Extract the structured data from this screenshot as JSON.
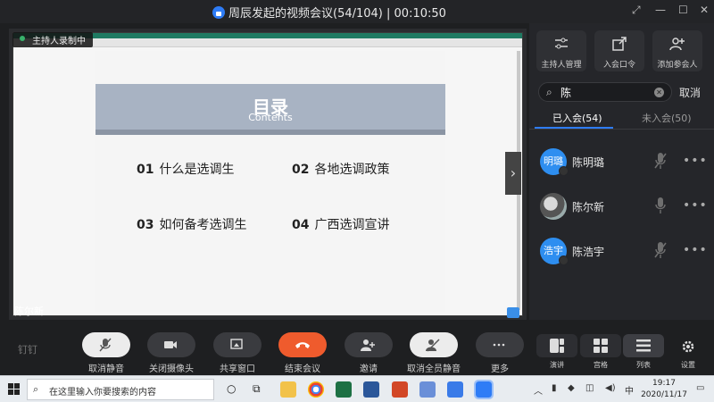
{
  "window": {
    "title": "周辰发起的视频会议(54/104)  |  00:10:50"
  },
  "stage": {
    "recording_badge": "主持人录制中",
    "speaker_name": "陈尔新",
    "slide": {
      "title": "目录",
      "subtitle": "Contents",
      "items": [
        {
          "num": "01",
          "text": "什么是选调生"
        },
        {
          "num": "02",
          "text": "各地选调政策"
        },
        {
          "num": "03",
          "text": "如何备考选调生"
        },
        {
          "num": "04",
          "text": "广西选调宣讲"
        }
      ]
    }
  },
  "panel": {
    "actions": [
      {
        "label": "主持人管理",
        "icon": "sliders-icon"
      },
      {
        "label": "入会口令",
        "icon": "share-icon"
      },
      {
        "label": "添加参会人",
        "icon": "add-user-icon"
      }
    ],
    "search": {
      "value": "陈",
      "cancel_label": "取消"
    },
    "tabs": [
      {
        "label": "已入会(54)",
        "active": true
      },
      {
        "label": "未入会(50)",
        "active": false
      }
    ],
    "members": [
      {
        "avatar_text": "明璐",
        "name": "陈明璐",
        "mic": "muted",
        "more": "•••"
      },
      {
        "avatar_text": "",
        "name": "陈尔新",
        "mic": "on",
        "more": "•••"
      },
      {
        "avatar_text": "浩宇",
        "name": "陈浩宇",
        "mic": "muted",
        "more": "•••"
      }
    ]
  },
  "toolbar": {
    "logo": "钉钉",
    "buttons": [
      {
        "label": "取消静音",
        "icon": "mic-off-icon"
      },
      {
        "label": "关闭摄像头",
        "icon": "camera-icon"
      },
      {
        "label": "共享窗口",
        "icon": "share-screen-icon"
      },
      {
        "label": "结束会议",
        "icon": "hangup-icon"
      },
      {
        "label": "邀请",
        "icon": "invite-icon"
      },
      {
        "label": "取消全员静音",
        "icon": "mute-all-icon"
      },
      {
        "label": "更多",
        "icon": "more-icon"
      }
    ],
    "views": [
      {
        "label": "演讲",
        "icon": "speaker-view-icon"
      },
      {
        "label": "宫格",
        "icon": "grid-view-icon"
      },
      {
        "label": "列表",
        "icon": "list-view-icon"
      },
      {
        "label": "设置",
        "icon": "gear-icon"
      }
    ]
  },
  "taskbar": {
    "search_placeholder": "在这里输入你要搜索的内容",
    "time": "19:17",
    "date": "2020/11/17",
    "ime": "中"
  }
}
